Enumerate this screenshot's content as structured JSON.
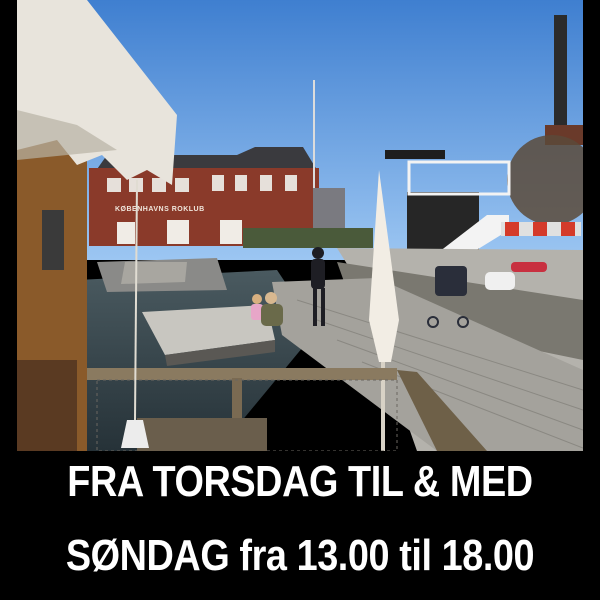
{
  "photo": {
    "building_sign": "KØBENHAVNS ROKLUB",
    "palette": {
      "sky": "#4f8fd6",
      "sky_light": "#8fbdf0",
      "brick": "#8a3a2a",
      "water": "#3a4a52",
      "deck": "#9a9890",
      "awning": "#e8e4dc"
    }
  },
  "caption": {
    "line1": "FRA TORSDAG TIL & MED",
    "line2": "SØNDAG fra 13.00 til 18.00"
  }
}
